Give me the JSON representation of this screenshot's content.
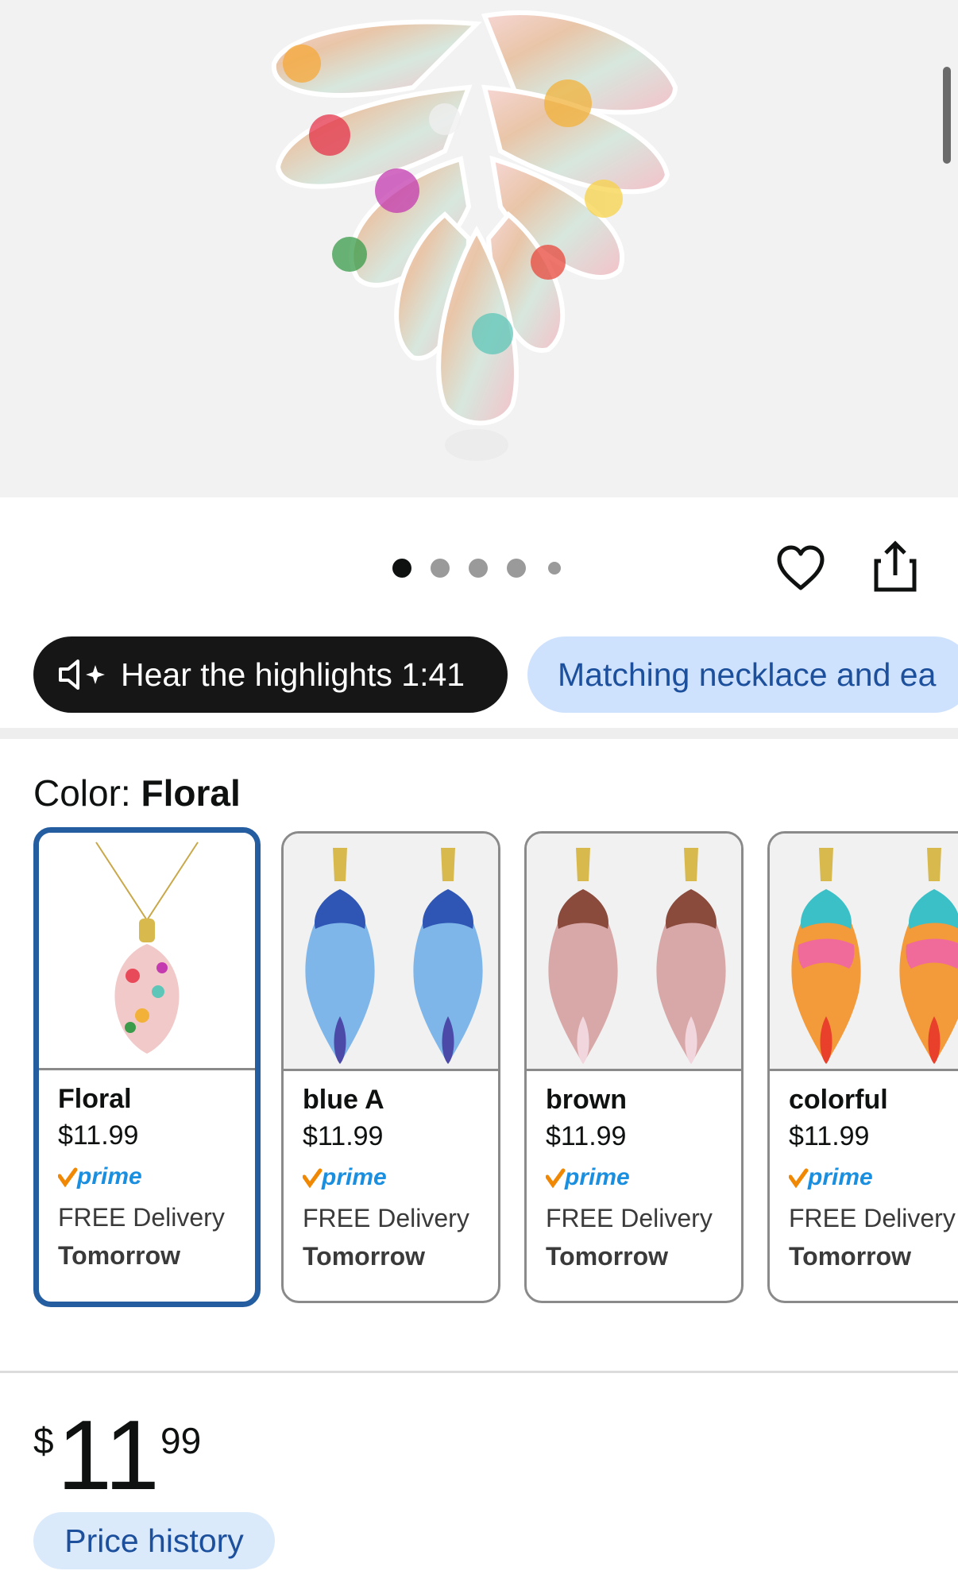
{
  "header": {
    "highlights_label": "Hear the highlights 1:41",
    "matching_label": "Matching necklace and ea"
  },
  "gallery": {
    "image_count": 5,
    "active_index": 0
  },
  "color": {
    "label": "Color:",
    "selected": "Floral"
  },
  "swatches": [
    {
      "name": "Floral",
      "price": "$11.99",
      "prime": "prime",
      "delivery": "FREE Delivery",
      "day": "Tomorrow"
    },
    {
      "name": "blue A",
      "price": "$11.99",
      "prime": "prime",
      "delivery": "FREE Delivery",
      "day": "Tomorrow"
    },
    {
      "name": "brown",
      "price": "$11.99",
      "prime": "prime",
      "delivery": "FREE Delivery",
      "day": "Tomorrow"
    },
    {
      "name": "colorful",
      "price": "$11.99",
      "prime": "prime",
      "delivery": "FREE Delivery",
      "day": "Tomorrow"
    }
  ],
  "price": {
    "currency": "$",
    "whole": "11",
    "fraction": "99",
    "history_label": "Price history"
  },
  "colors": {
    "accent_blue": "#245ea1",
    "link_blue": "#1c4f9c",
    "pill_bg": "#cfe2fd",
    "prime_orange": "#f08804"
  }
}
